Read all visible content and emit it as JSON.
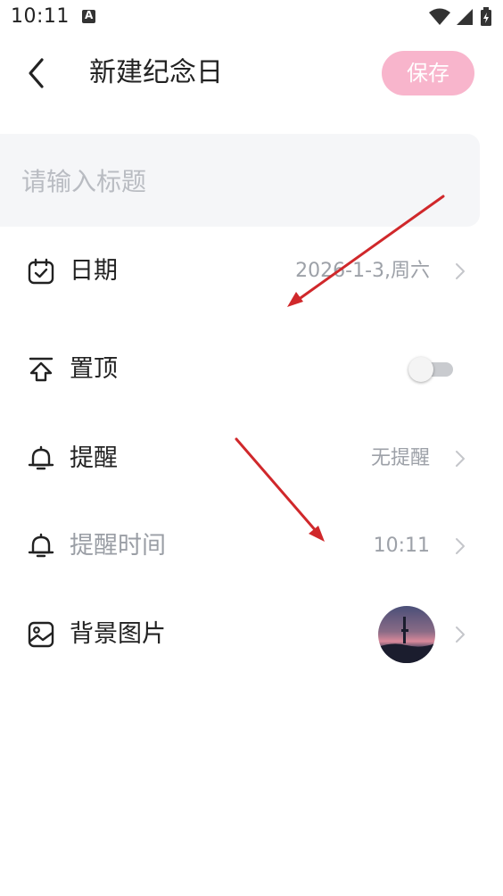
{
  "status_bar": {
    "time": "10:11",
    "app_icon_letter": "A",
    "icons": [
      "wifi-icon",
      "signal-icon",
      "battery-icon"
    ]
  },
  "header": {
    "back_icon": "chevron-left-icon",
    "title": "新建纪念日",
    "save_label": "保存"
  },
  "title_input": {
    "placeholder": "请输入标题",
    "value": ""
  },
  "rows": {
    "date": {
      "icon": "calendar-check-icon",
      "label": "日期",
      "value": "2026-1-3,周六"
    },
    "pin": {
      "icon": "pin-top-icon",
      "label": "置顶",
      "toggle_on": false
    },
    "reminder": {
      "icon": "bell-icon",
      "label": "提醒",
      "value": "无提醒"
    },
    "reminder_time": {
      "icon": "bell-icon",
      "label": "提醒时间",
      "value": "10:11"
    },
    "background": {
      "icon": "image-icon",
      "label": "背景图片"
    }
  },
  "colors": {
    "accent_pink": "#f8b5cc",
    "input_bg": "#f5f6f8",
    "secondary_text": "#9da1a8",
    "annotation_arrow": "#d0282b"
  }
}
